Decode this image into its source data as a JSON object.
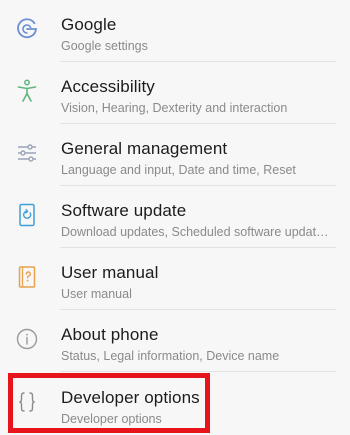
{
  "settings": {
    "items": [
      {
        "icon": "google-icon",
        "title": "Google",
        "subtitle": "Google settings"
      },
      {
        "icon": "accessibility-icon",
        "title": "Accessibility",
        "subtitle": "Vision, Hearing, Dexterity and interaction"
      },
      {
        "icon": "sliders-icon",
        "title": "General management",
        "subtitle": "Language and input, Date and time, Reset"
      },
      {
        "icon": "software-update-icon",
        "title": "Software update",
        "subtitle": "Download updates, Scheduled software update..."
      },
      {
        "icon": "user-manual-icon",
        "title": "User manual",
        "subtitle": "User manual"
      },
      {
        "icon": "info-icon",
        "title": "About phone",
        "subtitle": "Status, Legal information, Device name"
      },
      {
        "icon": "braces-icon",
        "title": "Developer options",
        "subtitle": "Developer options"
      }
    ]
  },
  "colors": {
    "background": "#f7f7f7",
    "title_text": "#1c1c1c",
    "subtitle_text": "#8a8a8a",
    "highlight_border": "#e8141c",
    "google_icon": "#6b8fd4",
    "accessibility_icon": "#5fb580",
    "sliders_icon": "#9aa4b8",
    "update_icon": "#3f9fd8",
    "manual_icon": "#e7a24b",
    "info_icon": "#9a9a9a",
    "braces_icon": "#8a8a8a"
  }
}
